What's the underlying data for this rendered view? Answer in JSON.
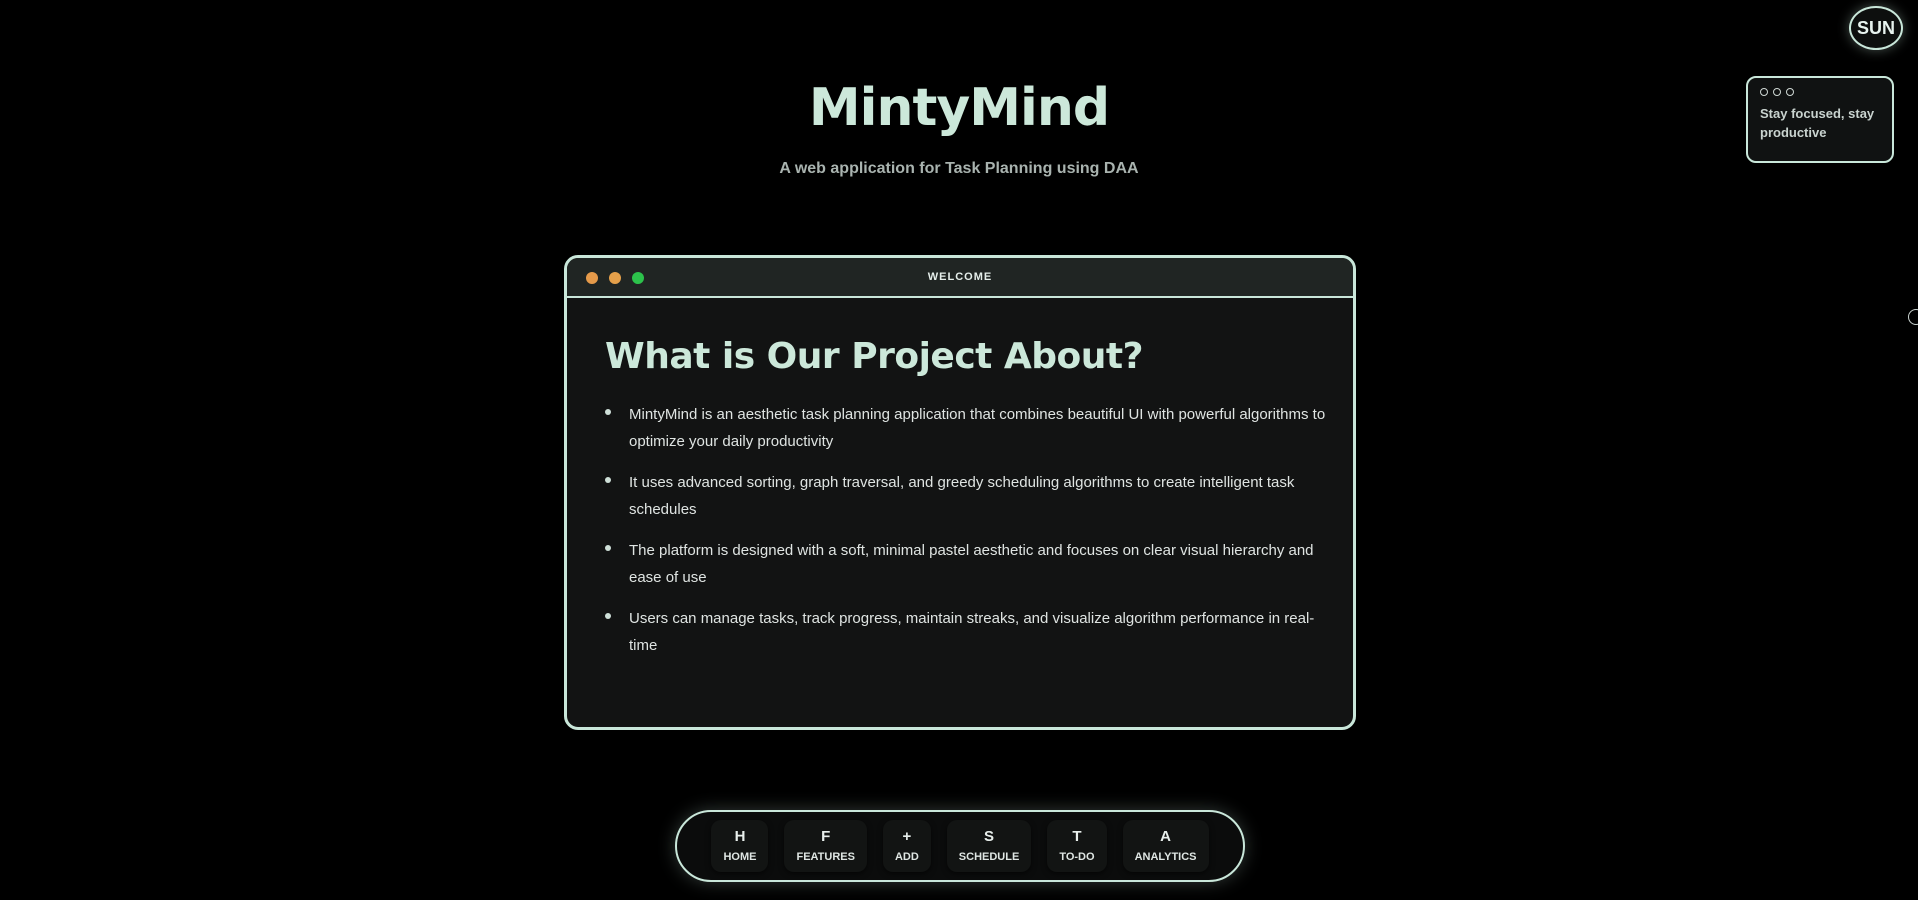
{
  "theme_toggle": {
    "label": "SUN"
  },
  "motivation": {
    "text": "Stay focused, stay productive"
  },
  "header": {
    "title": "MintyMind",
    "subtitle": "A web application for Task Planning using DAA"
  },
  "welcome_window": {
    "title": "WELCOME",
    "traffic_colors": [
      "#e59a4a",
      "#e5a04a",
      "#2cc24b"
    ],
    "heading": "What is Our Project About?",
    "bullets": [
      "MintyMind is an aesthetic task planning application that combines beautiful UI with powerful algorithms to optimize your daily productivity",
      "It uses advanced sorting, graph traversal, and greedy scheduling algorithms to create intelligent task schedules",
      "The platform is designed with a soft, minimal pastel aesthetic and focuses on clear visual hierarchy and ease of use",
      "Users can manage tasks, track progress, maintain streaks, and visualize algorithm performance in real-time"
    ]
  },
  "nav": {
    "items": [
      {
        "key": "H",
        "label": "HOME"
      },
      {
        "key": "F",
        "label": "FEATURES"
      },
      {
        "key": "+",
        "label": "ADD"
      },
      {
        "key": "S",
        "label": "SCHEDULE"
      },
      {
        "key": "T",
        "label": "TO-DO"
      },
      {
        "key": "A",
        "label": "ANALYTICS"
      }
    ]
  },
  "colors": {
    "accent": "#c9e7da",
    "background": "#000000",
    "card": "#121313"
  }
}
